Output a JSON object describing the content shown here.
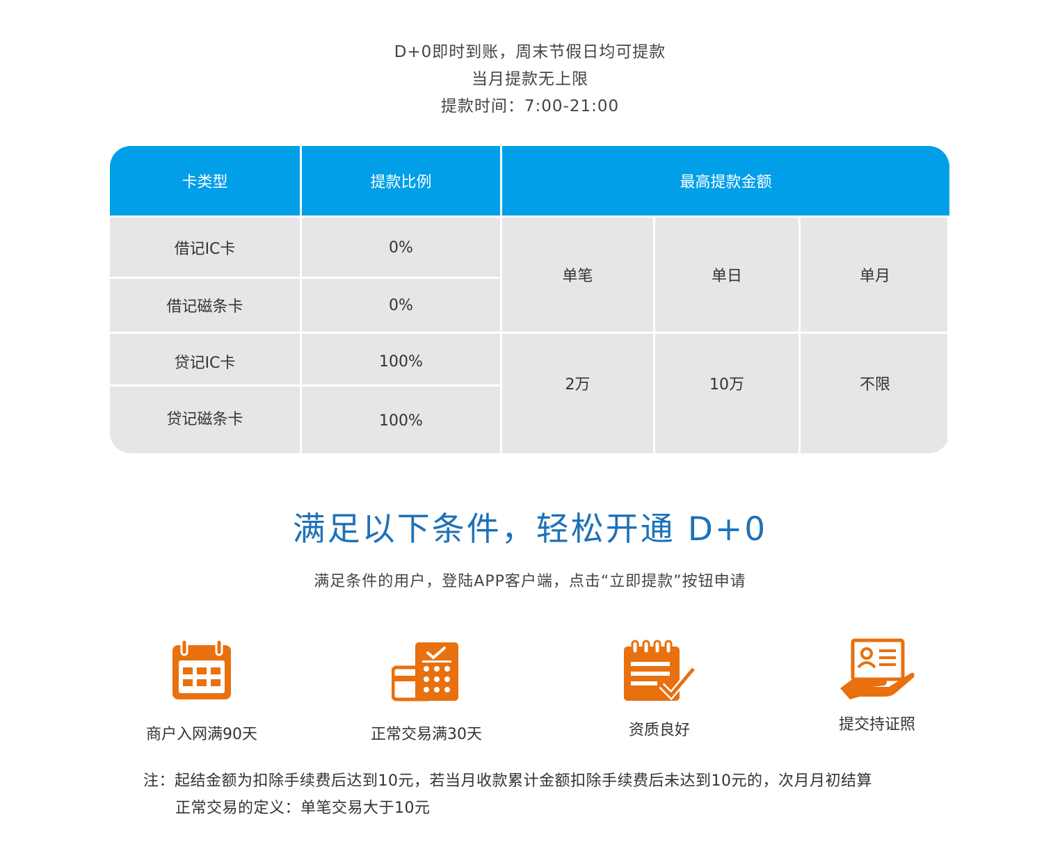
{
  "intro": {
    "line1": "D+0即时到账，周末节假日均可提款",
    "line2": "当月提款无上限",
    "line3": "提款时间：7:00-21:00"
  },
  "table": {
    "headers": {
      "card_type": "卡类型",
      "ratio": "提款比例",
      "max_amount": "最高提款金额"
    },
    "rows": [
      {
        "card": "借记IC卡",
        "ratio": "0%"
      },
      {
        "card": "借记磁条卡",
        "ratio": "0%"
      },
      {
        "card": "贷记IC卡",
        "ratio": "100%"
      },
      {
        "card": "贷记磁条卡",
        "ratio": "100%"
      }
    ],
    "limit_labels": {
      "single": "单笔",
      "daily": "单日",
      "monthly": "单月"
    },
    "limit_values": {
      "single": "2万",
      "daily": "10万",
      "monthly": "不限"
    }
  },
  "conditions": {
    "title": "满足以下条件，轻松开通  D+0",
    "subtitle": "满足条件的用户，登陆APP客户端，点击“立即提款”按钮申请",
    "items": [
      {
        "icon": "calendar-icon",
        "label": "商户入网满90天"
      },
      {
        "icon": "calculator-card-icon",
        "label": "正常交易满30天"
      },
      {
        "icon": "checklist-icon",
        "label": "资质良好"
      },
      {
        "icon": "id-card-hand-icon",
        "label": "提交持证照"
      }
    ]
  },
  "note": {
    "line1": "注：起结金额为扣除手续费后达到10元，若当月收款累计金额扣除手续费后未达到10元的，次月月初结算",
    "line2": "正常交易的定义：单笔交易大于10元"
  },
  "colors": {
    "header_blue": "#009fe8",
    "title_blue": "#1d71b8",
    "icon_orange": "#e8700e",
    "cell_gray": "#e6e6e6"
  }
}
